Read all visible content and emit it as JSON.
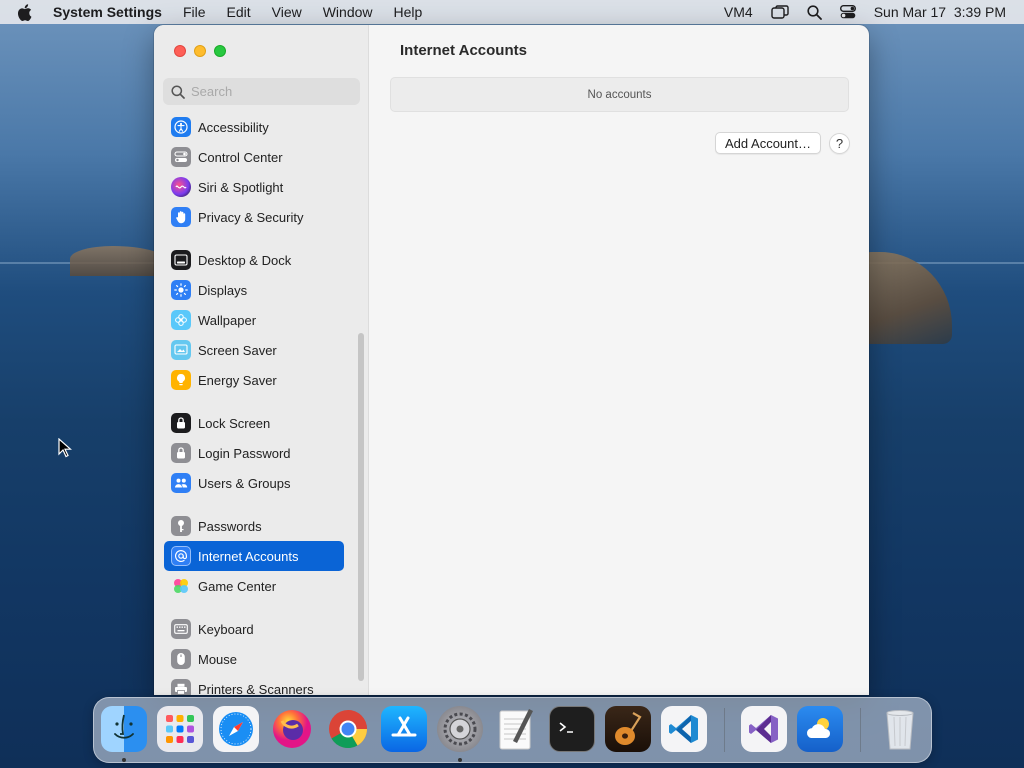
{
  "menubar": {
    "app_name": "System Settings",
    "menus": [
      "File",
      "Edit",
      "View",
      "Window",
      "Help"
    ],
    "status_text": "VM4",
    "datetime": "Sun Mar 17  3:39 PM"
  },
  "window": {
    "search": {
      "placeholder": "Search",
      "value": ""
    },
    "sidebar": {
      "items": [
        {
          "label": "Accessibility",
          "icon": "accessibility-icon",
          "color": "#1f7cf0"
        },
        {
          "label": "Control Center",
          "icon": "control-center-icon",
          "color": "#8e8e93"
        },
        {
          "label": "Siri & Spotlight",
          "icon": "siri-icon",
          "color": "#b144e0"
        },
        {
          "label": "Privacy & Security",
          "icon": "hand-icon",
          "color": "#2f7ff5"
        },
        {
          "label": "Desktop & Dock",
          "icon": "dock-icon",
          "color": "#1c1c1e"
        },
        {
          "label": "Displays",
          "icon": "sun-icon",
          "color": "#2f7ff5"
        },
        {
          "label": "Wallpaper",
          "icon": "flower-icon",
          "color": "#5ac8fa"
        },
        {
          "label": "Screen Saver",
          "icon": "screen-saver-icon",
          "color": "#5ac8fa"
        },
        {
          "label": "Energy Saver",
          "icon": "bulb-icon",
          "color": "#ffb300"
        },
        {
          "label": "Lock Screen",
          "icon": "lock-screen-icon",
          "color": "#1c1c1e"
        },
        {
          "label": "Login Password",
          "icon": "lock-icon",
          "color": "#8e8e93"
        },
        {
          "label": "Users & Groups",
          "icon": "users-icon",
          "color": "#2f7ff5"
        },
        {
          "label": "Passwords",
          "icon": "key-icon",
          "color": "#8e8e93"
        },
        {
          "label": "Internet Accounts",
          "icon": "at-icon",
          "color": "#2f7ff5",
          "selected": true
        },
        {
          "label": "Game Center",
          "icon": "game-center-icon",
          "color": "#ffffff"
        },
        {
          "label": "Keyboard",
          "icon": "keyboard-icon",
          "color": "#8e8e93"
        },
        {
          "label": "Mouse",
          "icon": "mouse-icon",
          "color": "#8e8e93"
        },
        {
          "label": "Printers & Scanners",
          "icon": "printer-icon",
          "color": "#8e8e93"
        }
      ]
    },
    "content": {
      "title": "Internet Accounts",
      "empty_text": "No accounts",
      "add_button": "Add Account…",
      "help_button": "?"
    }
  },
  "dock": {
    "apps": [
      "Finder",
      "Launchpad",
      "Safari",
      "Firefox",
      "Chrome",
      "App Store",
      "System Settings",
      "TextEdit",
      "Terminal",
      "GarageBand",
      "Visual Studio Code",
      "Visual Studio",
      "Weather",
      "Trash"
    ]
  }
}
